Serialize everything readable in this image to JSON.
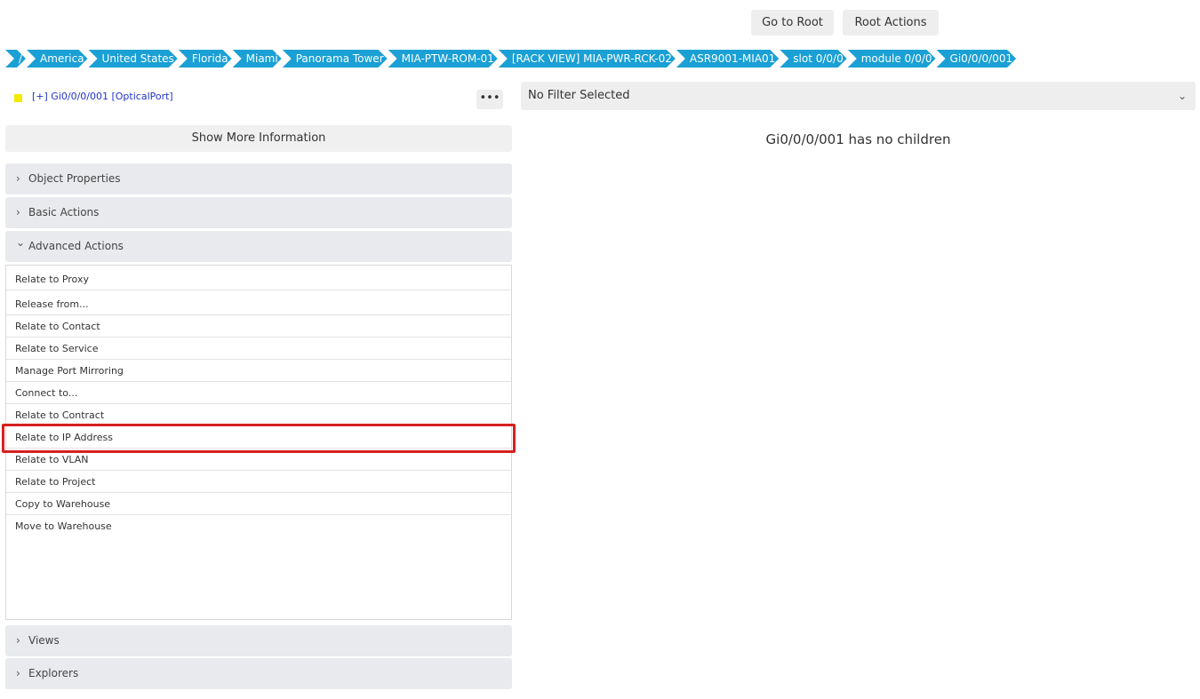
{
  "top_buttons": {
    "go_to_root": "Go to Root",
    "root_actions": "Root Actions"
  },
  "breadcrumb": [
    "/",
    "America",
    "United States",
    "Florida",
    "Miami",
    "Panorama Tower",
    "MIA-PTW-ROM-01",
    "[RACK VIEW] MIA-PWR-RCK-02",
    "ASR9001-MIA01",
    "slot 0/0/0",
    "module 0/0/0",
    "Gi0/0/0/001"
  ],
  "object": {
    "title": "[+] Gi0/0/0/001 [OpticalPort]",
    "more_label": "•••",
    "show_more": "Show More Information"
  },
  "sections": {
    "object_properties": "Object Properties",
    "basic_actions": "Basic Actions",
    "advanced_actions": "Advanced Actions",
    "views": "Views",
    "explorers": "Explorers"
  },
  "icons": {
    "chevron_right": "›",
    "chevron_down": "⌄"
  },
  "actions": [
    "Relate to Proxy",
    "Release from...",
    "Relate to Contact",
    "Relate to Service",
    "Manage Port Mirroring",
    "Connect to...",
    "Relate to Contract",
    "Relate to IP Address",
    "Relate to VLAN",
    "Relate to Project",
    "Copy to Warehouse",
    "Move to Warehouse"
  ],
  "filter": {
    "selected": "No Filter Selected"
  },
  "children_message": "Gi0/0/0/001 has no children",
  "colors": {
    "breadcrumb": "#1aa0d4",
    "highlight": "#d62020",
    "status_square": "#f2ea00"
  }
}
